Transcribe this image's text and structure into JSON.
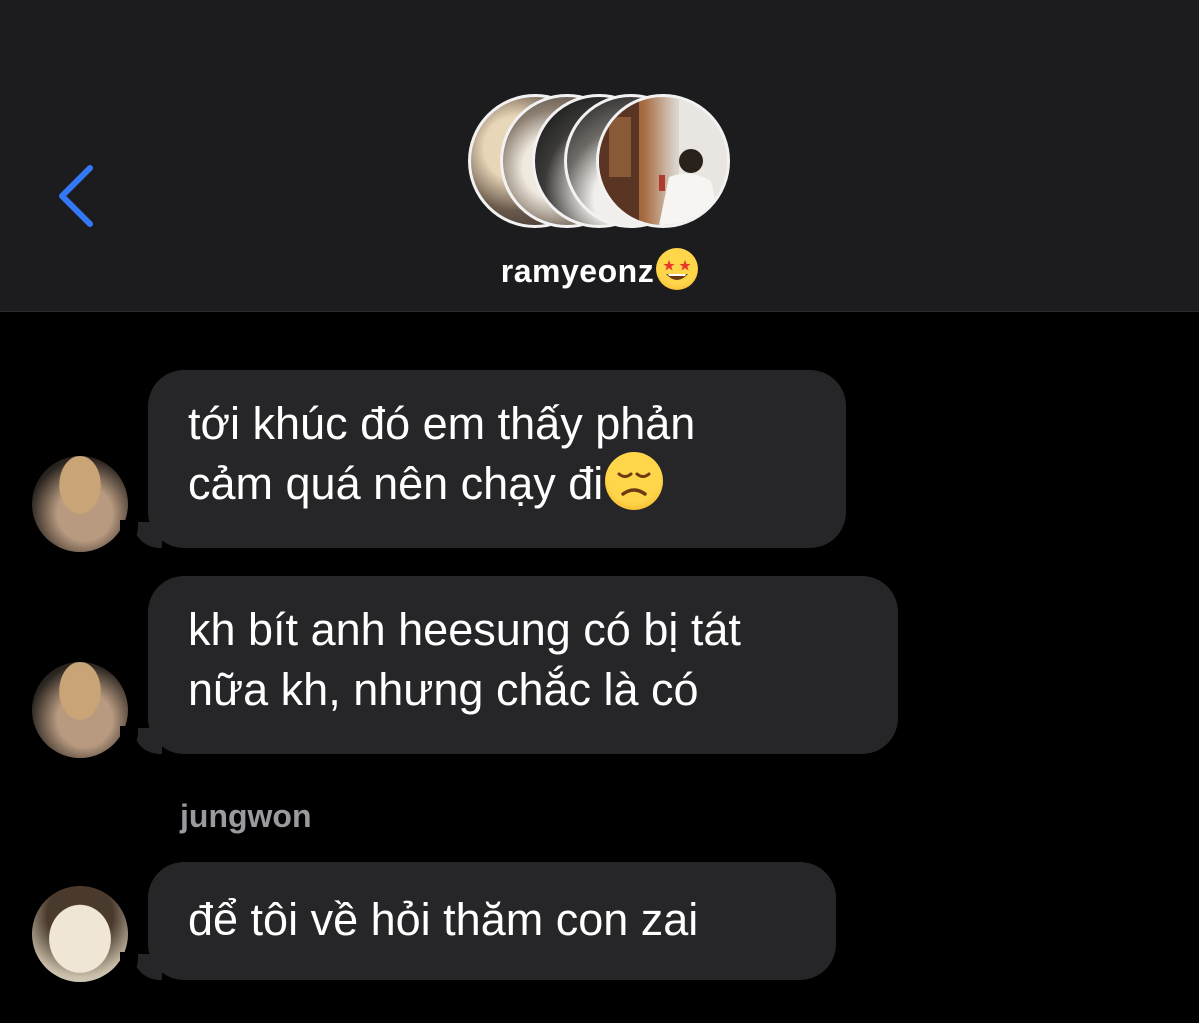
{
  "header": {
    "back_icon": "chevron-left-icon",
    "accent_color": "#3478f6",
    "title": "ramyeonz",
    "title_emoji": "star-struck-emoji-icon"
  },
  "messages": [
    {
      "lines": [
        "tới khúc đó em thấy phản",
        "cảm quá nên chạy đi"
      ],
      "trailing_emoji": "disappointed-face-emoji-icon"
    },
    {
      "lines": [
        "kh bít anh heesung có bị tát",
        "nữa kh, nhưng chắc là có"
      ]
    },
    {
      "sender": "jungwon",
      "lines": [
        "để tôi về hỏi thăm con zai"
      ]
    }
  ]
}
